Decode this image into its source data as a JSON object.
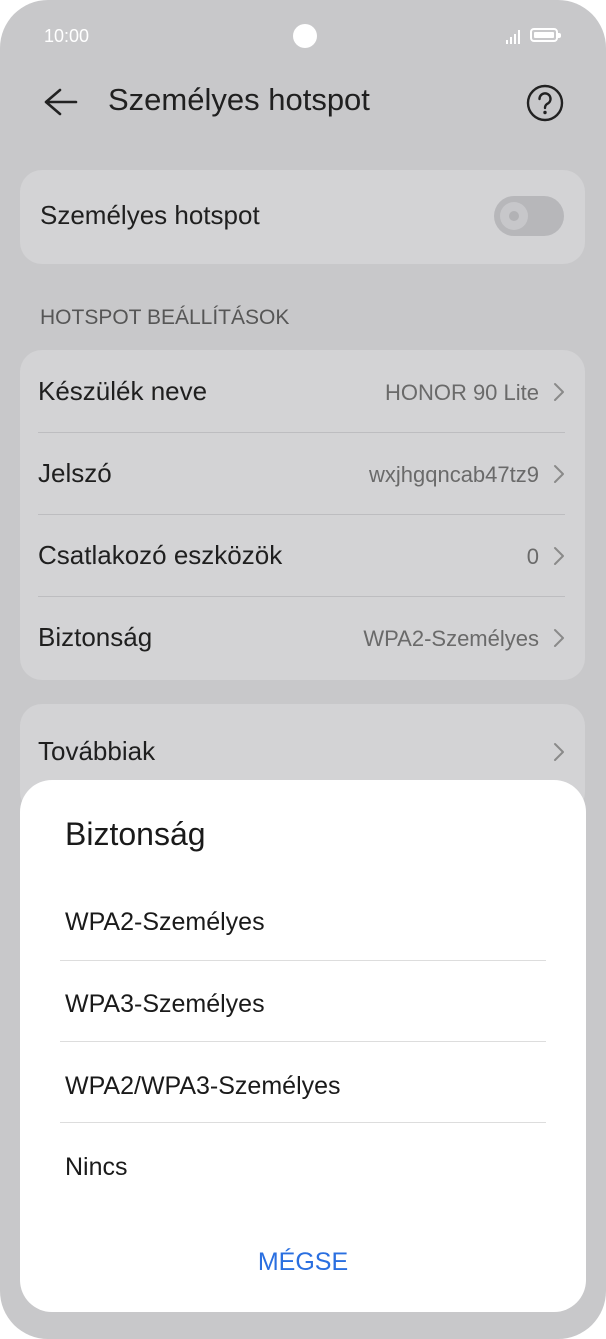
{
  "status_bar": {
    "time": "10:00"
  },
  "header": {
    "title": "Személyes hotspot"
  },
  "hotspot_toggle": {
    "label": "Személyes hotspot",
    "enabled": false
  },
  "section": {
    "title": "HOTSPOT BEÁLLÍTÁSOK"
  },
  "settings": [
    {
      "label": "Készülék neve",
      "value": "HONOR 90 Lite"
    },
    {
      "label": "Jelszó",
      "value": "wxjhgqncab47tz9"
    },
    {
      "label": "Csatlakozó eszközök",
      "value": "0"
    },
    {
      "label": "Biztonság",
      "value": "WPA2-Személyes"
    }
  ],
  "more": {
    "label": "Továbbiak"
  },
  "dialog": {
    "title": "Biztonság",
    "options": [
      "WPA2-Személyes",
      "WPA3-Személyes",
      "WPA2/WPA3-Személyes",
      "Nincs"
    ],
    "cancel": "MÉGSE"
  },
  "colors": {
    "accent": "#2a6fe0",
    "overlay_bg": "#c8c8ca"
  }
}
